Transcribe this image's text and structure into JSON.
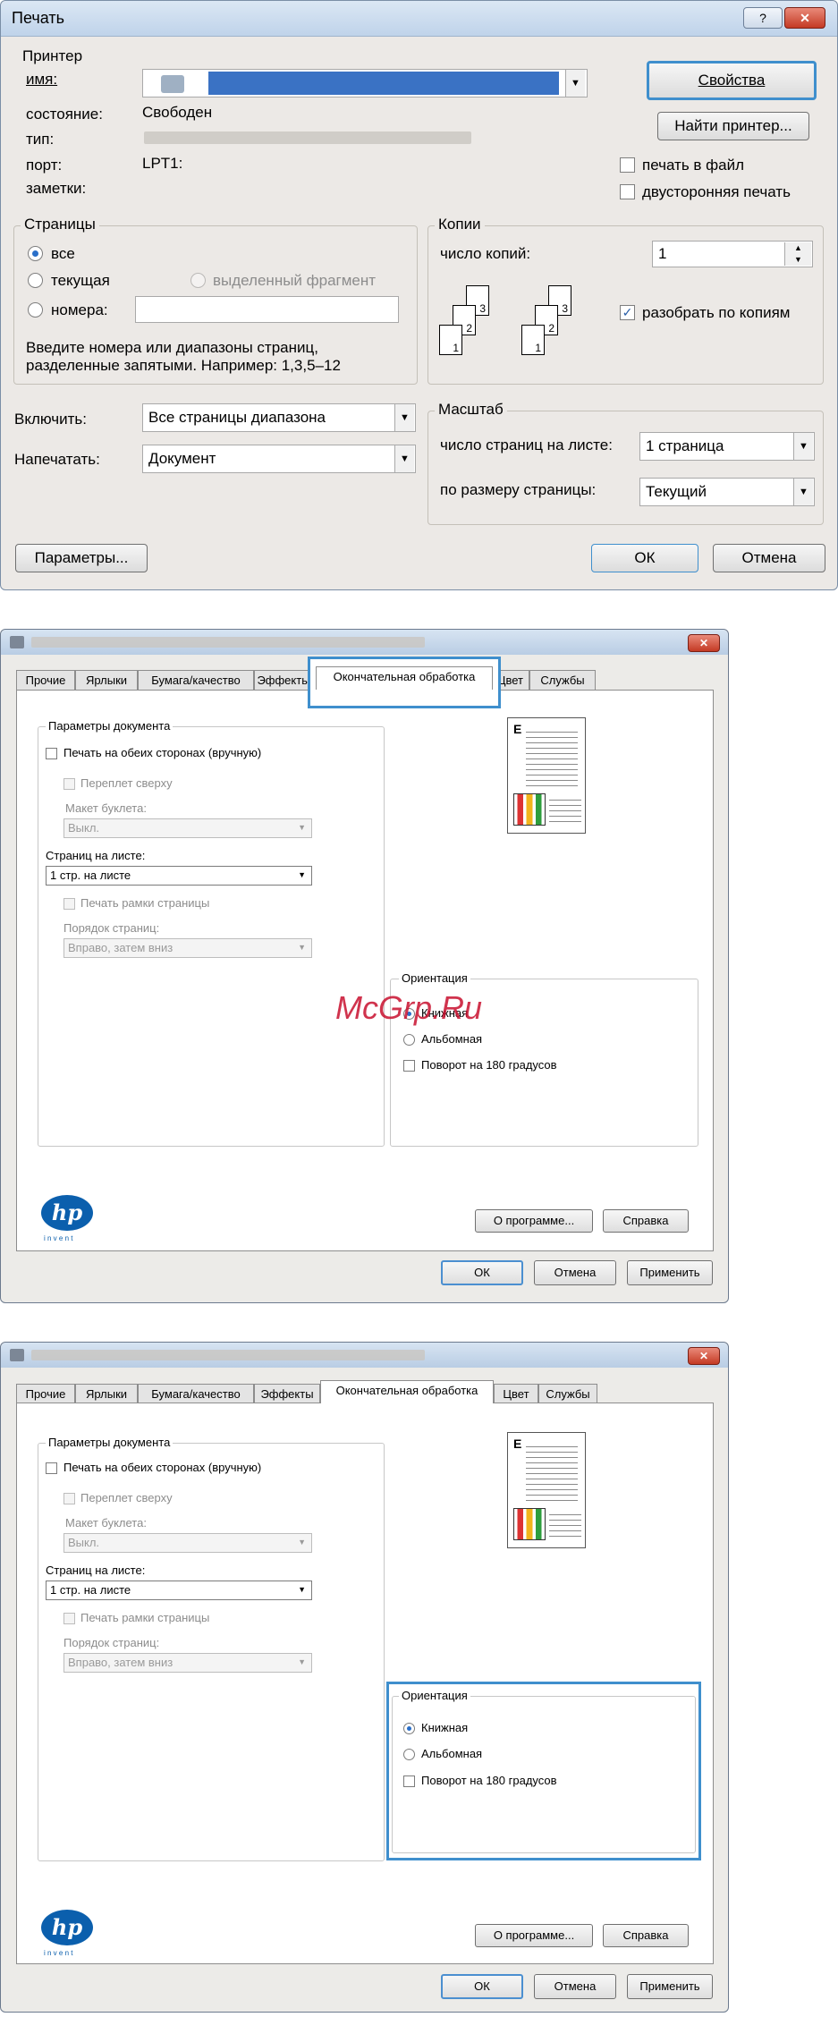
{
  "print_dialog": {
    "title": "Печать",
    "help_glyph": "?",
    "close_glyph": "✕",
    "printer_group": "Принтер",
    "name_label": "имя:",
    "status_label": "состояние:",
    "status_value": "Свободен",
    "type_label": "тип:",
    "port_label": "порт:",
    "port_value": "LPT1:",
    "notes_label": "заметки:",
    "properties_button": "Свойства",
    "find_printer_button": "Найти принтер...",
    "print_to_file": "печать в файл",
    "duplex": "двусторонняя печать",
    "pages_group": "Страницы",
    "pages_all": "все",
    "pages_current": "текущая",
    "pages_selection": "выделенный фрагмент",
    "pages_numbers": "номера:",
    "pages_hint_1": "Введите номера или диапазоны страниц,",
    "pages_hint_2": "разделенные запятыми. Например: 1,3,5–12",
    "copies_group": "Копии",
    "copies_label": "число копий:",
    "copies_value": "1",
    "collate": "разобрать по копиям",
    "collate_stack_1": [
      "3",
      "2",
      "1"
    ],
    "collate_stack_2": [
      "3",
      "2",
      "1"
    ],
    "include_label": "Включить:",
    "include_value": "Все страницы диапазона",
    "print_what_label": "Напечатать:",
    "print_what_value": "Документ",
    "scale_group": "Масштаб",
    "pages_per_sheet_label": "число страниц на листе:",
    "pages_per_sheet_value": "1 страница",
    "fit_to_label": "по размеру страницы:",
    "fit_to_value": "Текущий",
    "options_button": "Параметры...",
    "ok_button": "ОК",
    "cancel_button": "Отмена"
  },
  "properties_1": {
    "close_glyph": "✕",
    "tabs": [
      "Прочие",
      "Ярлыки",
      "Бумага/качество",
      "Эффекты",
      "Окончательная обработка",
      "Цвет",
      "Службы"
    ],
    "active_tab": "Окончательная обработка",
    "doc_options_group": "Параметры документа",
    "two_sided": "Печать на обеих сторонах (вручную)",
    "flip_up": "Переплет сверху",
    "booklet_label": "Макет буклета:",
    "booklet_value": "Выкл.",
    "pages_per_sheet_label": "Страниц на листе:",
    "pages_per_sheet_value": "1 стр. на листе",
    "page_borders": "Печать рамки страницы",
    "page_order_label": "Порядок страниц:",
    "page_order_value": "Вправо, затем вниз",
    "orientation_group": "Ориентация",
    "portrait": "Книжная",
    "landscape": "Альбомная",
    "rotate": "Поворот на 180 градусов",
    "watermark": "McGrp.Ru",
    "hp_logo": "hp",
    "hp_invent": "i n v e n t",
    "about_button": "О программе...",
    "help_button": "Справка",
    "ok_button": "ОК",
    "cancel_button": "Отмена",
    "apply_button": "Применить"
  },
  "properties_2": {
    "close_glyph": "✕",
    "tabs": [
      "Прочие",
      "Ярлыки",
      "Бумага/качество",
      "Эффекты",
      "Окончательная обработка",
      "Цвет",
      "Службы"
    ],
    "doc_options_group": "Параметры документа",
    "two_sided": "Печать на обеих сторонах (вручную)",
    "flip_up": "Переплет сверху",
    "booklet_label": "Макет буклета:",
    "booklet_value": "Выкл.",
    "pages_per_sheet_label": "Страниц на листе:",
    "pages_per_sheet_value": "1 стр. на листе",
    "page_borders": "Печать рамки страницы",
    "page_order_label": "Порядок страниц:",
    "page_order_value": "Вправо, затем вниз",
    "orientation_group": "Ориентация",
    "portrait": "Книжная",
    "landscape": "Альбомная",
    "rotate": "Поворот на 180 градусов",
    "hp_logo": "hp",
    "hp_invent": "i n v e n t",
    "about_button": "О программе...",
    "help_button": "Справка",
    "ok_button": "ОК",
    "cancel_button": "Отмена",
    "apply_button": "Применить"
  },
  "colors": {
    "highlight": "#3f8fcd",
    "window_bg": "#ece9e6",
    "watermark": "#c8102e",
    "hp_blue": "#0b5fad"
  }
}
